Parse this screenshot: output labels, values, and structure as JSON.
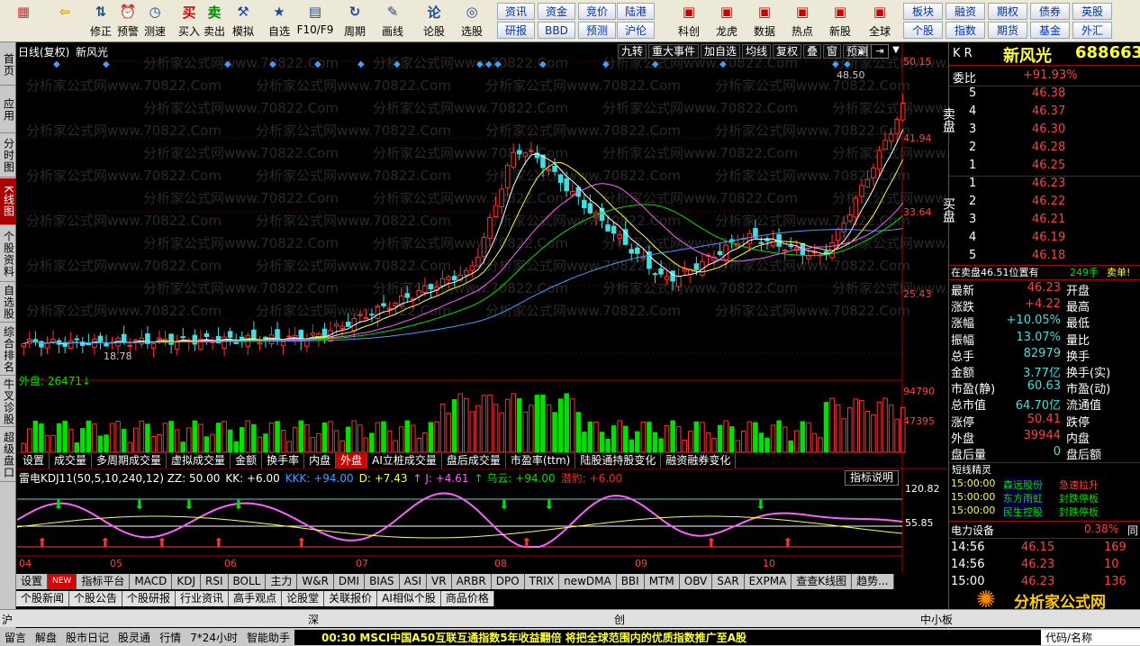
{
  "toolbar": {
    "buttons": [
      {
        "label": "",
        "icon": "windows-logo-icon"
      },
      {
        "label": "",
        "icon": "back-arrow-icon"
      },
      {
        "label": "修正",
        "icon": "updown-arrow-icon"
      },
      {
        "label": "预警",
        "icon": "alarm-icon"
      },
      {
        "label": "测速",
        "icon": "clock-icon"
      },
      {
        "label": "买入",
        "icon": "buy-icon"
      },
      {
        "label": "卖出",
        "icon": "sell-icon"
      },
      {
        "label": "模拟",
        "icon": "hammer-icon"
      },
      {
        "label": "自选",
        "icon": "star-icon"
      },
      {
        "label": "F10/F9",
        "icon": "grid-icon"
      },
      {
        "label": "周期",
        "icon": "cycle-icon"
      },
      {
        "label": "画线",
        "icon": "pen-icon"
      },
      {
        "label": "论股",
        "icon": "chat-icon"
      },
      {
        "label": "选股",
        "icon": "select-icon"
      }
    ],
    "textbtns": [
      [
        "资讯",
        "资金",
        "竞价",
        "陆港"
      ],
      [
        "研报",
        "BBD",
        "预测",
        "沪伦"
      ]
    ],
    "icons2": [
      {
        "label": "科创"
      },
      {
        "label": "龙虎"
      },
      {
        "label": "数据"
      },
      {
        "label": "热点"
      },
      {
        "label": "新股"
      },
      {
        "label": "全球"
      }
    ],
    "textbtns2": [
      [
        "板块",
        "融资",
        "期权",
        "债券",
        "英股"
      ],
      [
        "个股",
        "指数",
        "期货",
        "基金",
        "外汇"
      ]
    ]
  },
  "sidebar": [
    "首页",
    "应用",
    "分时图",
    "K线图",
    "个股资料",
    "自选股",
    "综合排名",
    "牛叉诊股",
    "超级盘口"
  ],
  "chart": {
    "title": "日线(复权)",
    "name": "新风光",
    "hdrbtns": [
      "九转",
      "重大事件",
      "加自选",
      "均线",
      "复权",
      "叠",
      "窗",
      "预测"
    ],
    "price_labels": [
      "50.15",
      "41.94",
      "33.64",
      "25.43"
    ],
    "max_label": "48.50",
    "min_label": "18.78",
    "vol_title": "外盘: 26471↓",
    "vol_labels": [
      "94790",
      "47395"
    ],
    "tabs1": [
      "设置",
      "成交量",
      "多周期成交量",
      "虚拟成交量",
      "金额",
      "换手率",
      "内盘",
      "外盘",
      "AI立桩成交量",
      "盘后成交量",
      "市盈率(ttm)",
      "陆股通持股变化",
      "融资融券变化"
    ],
    "ind_title": "雷电KDJ11(50,5,10,240,12) ZZ: 50.00",
    "ind_vals": [
      {
        "t": "KK: +6.00",
        "c": "#ffffff"
      },
      {
        "t": "KKK: +94.00",
        "c": "#40a0ff"
      },
      {
        "t": "D: +7.43",
        "c": "#ffff40"
      },
      {
        "t": "↑ J: +4.61",
        "c": "#ff60ff"
      },
      {
        "t": "↑ 乌云: +94.00",
        "c": "#00e000"
      },
      {
        "t": "潜豹: +6.00",
        "c": "#ff2020"
      }
    ],
    "ind_button": "指标说明",
    "ind_labels": [
      "120.82",
      "55.85"
    ],
    "months": [
      "04",
      "05",
      "06",
      "07",
      "08",
      "09",
      "10"
    ],
    "tabs2": [
      "设置",
      "NEW",
      "指标平台",
      "MACD",
      "KDJ",
      "RSI",
      "BOLL",
      "主力",
      "W&R",
      "DMI",
      "BIAS",
      "ASI",
      "VR",
      "ARBR",
      "DPO",
      "TRIX",
      "newDMA",
      "BBI",
      "MTM",
      "OBV",
      "SAR",
      "EXPMA",
      "查查K线图",
      "趋势..."
    ],
    "tabs3": [
      "个股新闻",
      "个股公告",
      "个股研报",
      "行业资讯",
      "高手观点",
      "论股堂",
      "关联报价",
      "AI相似个股",
      "商品价格"
    ],
    "watermark": "分析家公式网www.70822.Com"
  },
  "right": {
    "kr": "K R",
    "name": "新风光",
    "code": "688663",
    "weibi_label": "委比",
    "weibi": "+91.93%",
    "sell_label": "卖盘",
    "buy_label": "买盘",
    "asks": [
      [
        "5",
        "46.38"
      ],
      [
        "4",
        "46.37"
      ],
      [
        "3",
        "46.30"
      ],
      [
        "2",
        "46.28"
      ],
      [
        "1",
        "46.25"
      ]
    ],
    "bids": [
      [
        "1",
        "46.23"
      ],
      [
        "2",
        "46.22"
      ],
      [
        "3",
        "46.21"
      ],
      [
        "4",
        "46.19"
      ],
      [
        "5",
        "46.18"
      ]
    ],
    "status": "在卖盘46.51位置有",
    "status_vol": "249手",
    "status_tag": "卖单!",
    "quotes": [
      [
        "最新",
        "46.23",
        "开盘",
        ""
      ],
      [
        "涨跌",
        "+4.22",
        "最高",
        ""
      ],
      [
        "涨幅",
        "+10.05%",
        "最低",
        ""
      ],
      [
        "振幅",
        "13.07%",
        "量比",
        ""
      ],
      [
        "总手",
        "82979",
        "换手",
        ""
      ],
      [
        "金额",
        "3.77亿",
        "换手(实)",
        ""
      ],
      [
        "市盈(静)",
        "60.63",
        "市盈(动)",
        ""
      ],
      [
        "总市值",
        "64.70亿",
        "流通值",
        ""
      ],
      [
        "涨停",
        "50.41",
        "跌停",
        ""
      ],
      [
        "外盘",
        "39944",
        "内盘",
        ""
      ],
      [
        "盘后量",
        "0",
        "盘后额",
        ""
      ]
    ],
    "jingling_title": "短线精灵",
    "jingling": [
      [
        "15:00:00",
        "森远股份",
        "急速拉升"
      ],
      [
        "15:00:00",
        "东方雨虹",
        "封跌停板"
      ],
      [
        "15:00:00",
        "民生控股",
        "封跌停板"
      ]
    ],
    "sector": "电力设备",
    "sector_pct": "0.38%",
    "sector_tail": "同",
    "ticks": [
      [
        "14:56",
        "46.15",
        "169"
      ],
      [
        "14:56",
        "46.23",
        "10"
      ],
      [
        "15:00",
        "46.23",
        "136"
      ]
    ],
    "logo": "分析家公式网",
    "logo_url": "www.70822.com"
  },
  "status_rows": {
    "row1": [
      "沪",
      "深",
      "创",
      "中小板"
    ],
    "row2": [
      "留言",
      "解盘",
      "股市日记",
      "股灵通",
      "行情",
      "7*24小时",
      "智能助手"
    ],
    "ticker": "00:30 MSCI中国A50互联互通指数5年收益翻倍 将把全球范围内的优质指数推广至A股",
    "tail": "代码/名称"
  }
}
